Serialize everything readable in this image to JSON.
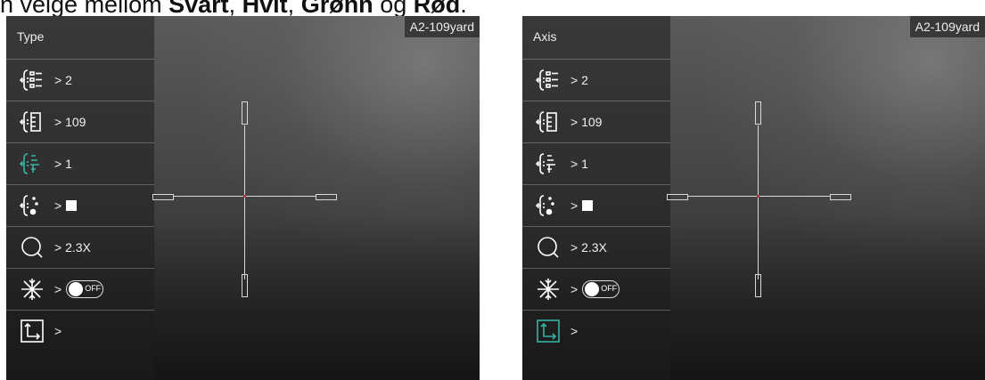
{
  "caption": {
    "prefix": "n velge mellom ",
    "opt1": "Svart",
    "sep1": ", ",
    "opt2": "Hvit",
    "sep2": ", ",
    "opt3": "Grønn",
    "sep3": " og ",
    "opt4": "Rød",
    "end": "."
  },
  "colors": {
    "accent": "#38b3a3",
    "menu_text": "#f0f0f0",
    "crosshair": "#d8d8d8",
    "center": "#a03a3a"
  },
  "left_panel": {
    "title": "Type",
    "badge": "A2-109yard",
    "items": [
      {
        "icon": "profile-icon",
        "value": "> 2"
      },
      {
        "icon": "distance-icon",
        "value": "> 109"
      },
      {
        "icon": "reticle-type-icon",
        "value": "> 1",
        "active": true
      },
      {
        "icon": "reticle-color-icon",
        "value": ">"
      },
      {
        "icon": "zoom-icon",
        "value": "> 2.3X"
      },
      {
        "icon": "freeze-icon",
        "value": ">",
        "toggle": "OFF"
      },
      {
        "icon": "axis-icon",
        "value": ">"
      }
    ]
  },
  "right_panel": {
    "title": "Axis",
    "badge": "A2-109yard",
    "items": [
      {
        "icon": "profile-icon",
        "value": "> 2"
      },
      {
        "icon": "distance-icon",
        "value": "> 109"
      },
      {
        "icon": "reticle-type-icon",
        "value": "> 1"
      },
      {
        "icon": "reticle-color-icon",
        "value": ">"
      },
      {
        "icon": "zoom-icon",
        "value": "> 2.3X"
      },
      {
        "icon": "freeze-icon",
        "value": ">",
        "toggle": "OFF"
      },
      {
        "icon": "axis-icon",
        "value": ">",
        "active": true
      }
    ]
  }
}
